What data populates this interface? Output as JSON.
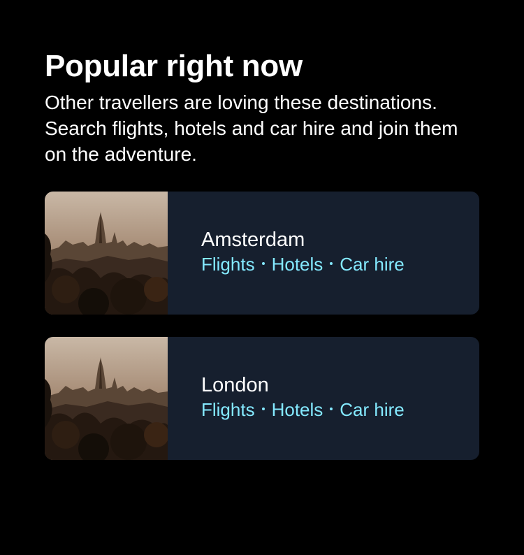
{
  "section": {
    "title": "Popular right now",
    "subtitle": "Other travellers are loving these destinations. Search flights, hotels and car hire and join them on the adventure."
  },
  "destinations": [
    {
      "name": "Amsterdam",
      "links": [
        "Flights",
        "Hotels",
        "Car hire"
      ],
      "image_icon": "city-skyline-photo"
    },
    {
      "name": "London",
      "links": [
        "Flights",
        "Hotels",
        "Car hire"
      ],
      "image_icon": "city-skyline-photo"
    }
  ],
  "colors": {
    "background": "#000000",
    "card": "#161f2e",
    "link": "#84e9ff",
    "text": "#ffffff"
  }
}
